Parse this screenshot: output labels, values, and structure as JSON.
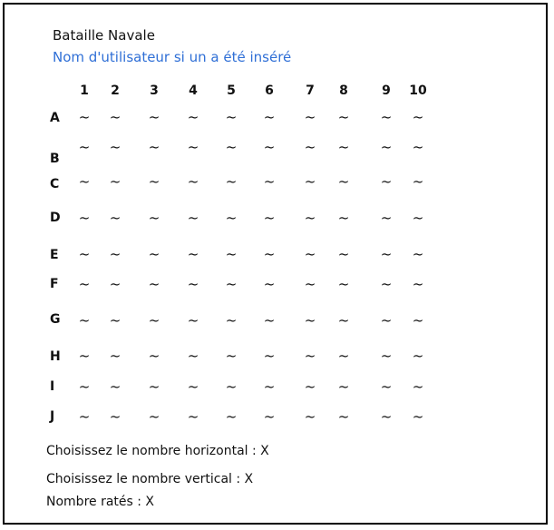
{
  "header": {
    "title": "Bataille Navale",
    "username": "Nom d'utilisateur si un a été inséré"
  },
  "colors": {
    "username": "#2f6fd6",
    "text": "#111111",
    "border": "#000000"
  },
  "grid": {
    "columns": [
      "1",
      "2",
      "3",
      "4",
      "5",
      "6",
      "7",
      "8",
      "9",
      "10"
    ],
    "rows": [
      "A",
      "B",
      "C",
      "D",
      "E",
      "F",
      "G",
      "H",
      "I",
      "J"
    ],
    "cell_symbol": "~"
  },
  "info": {
    "horizontal": "Choisissez le nombre horizontal : X",
    "vertical": "Choisissez le nombre vertical : X",
    "missed": "Nombre ratés : X"
  }
}
